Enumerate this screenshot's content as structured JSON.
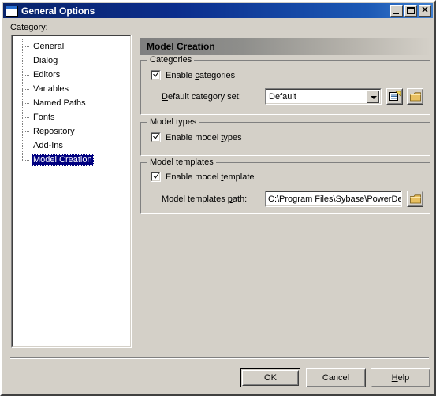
{
  "window": {
    "title": "General Options",
    "icon": "window-icon",
    "buttons": {
      "minimize": "Minimize",
      "maximize": "Maximize",
      "close": "Close"
    }
  },
  "category": {
    "label": "Category:",
    "items": [
      {
        "label": "General",
        "selected": false
      },
      {
        "label": "Dialog",
        "selected": false
      },
      {
        "label": "Editors",
        "selected": false
      },
      {
        "label": "Variables",
        "selected": false
      },
      {
        "label": "Named Paths",
        "selected": false
      },
      {
        "label": "Fonts",
        "selected": false
      },
      {
        "label": "Repository",
        "selected": false
      },
      {
        "label": "Add-Ins",
        "selected": false
      },
      {
        "label": "Model Creation",
        "selected": true
      }
    ]
  },
  "panel": {
    "header": "Model Creation",
    "groups": {
      "categories": {
        "title": "Categories",
        "enable_checkbox": {
          "label_pre": "Enable ",
          "label_accel": "c",
          "label_post": "ategories",
          "checked": true
        },
        "default_set_label_pre": "",
        "default_set_label_accel": "D",
        "default_set_label_post": "efault category set:",
        "combo_value": "Default",
        "properties_button": "properties-icon",
        "folder_button": "folder-icon"
      },
      "model_types": {
        "title": "Model types",
        "enable_checkbox": {
          "label_pre": "Enable model ",
          "label_accel": "t",
          "label_post": "ypes",
          "checked": true
        }
      },
      "model_templates": {
        "title": "Model templates",
        "enable_checkbox": {
          "label_pre": "Enable model ",
          "label_accel": "t",
          "label_post": "emplate",
          "checked": true
        },
        "path_label_pre": "Model templates ",
        "path_label_accel": "p",
        "path_label_post": "ath:",
        "path_value": "C:\\Program Files\\Sybase\\PowerDe",
        "folder_button": "folder-icon"
      }
    }
  },
  "footer": {
    "ok": "OK",
    "cancel": "Cancel",
    "help_pre": "",
    "help_accel": "H",
    "help_post": "elp"
  },
  "colors": {
    "dialog_face": "#d4d0c8",
    "title_gradient_start": "#0a246a",
    "title_gradient_end": "#3f7fd0",
    "selection": "#000080",
    "header_gradient_start": "#7f7f7f",
    "header_gradient_end": "#d4d0c8",
    "folder_icon": "#e8c060"
  }
}
